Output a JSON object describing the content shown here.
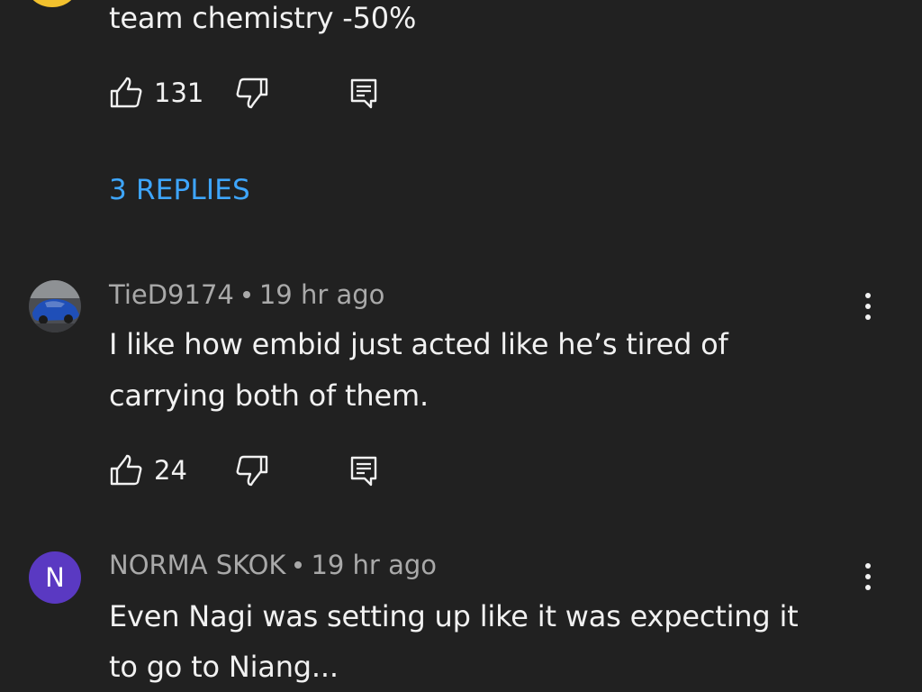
{
  "colors": {
    "background": "#212121",
    "primary_text": "#f1f1f1",
    "meta_text": "#a9a9a9",
    "link": "#3ea6ff",
    "avatar_letter_bg": "#5a39c2",
    "partial_avatar": "#f2c12e"
  },
  "comment_top": {
    "text_last_line": "team chemistry -50%",
    "likes": "131",
    "icons": [
      "thumbs-up-icon",
      "thumbs-down-icon",
      "reply-icon"
    ]
  },
  "replies_link": "3 REPLIES",
  "comments": [
    {
      "author": "TieD9174",
      "time": "19 hr ago",
      "avatar_icon": "car-avatar-image",
      "lines": [
        "I like how embid just acted like he’s tired of",
        "carrying both of them."
      ],
      "likes": "24"
    },
    {
      "author": "NORMA SKOK",
      "time": "19 hr ago",
      "avatar_letter": "N",
      "lines": [
        "Even Nagi was setting up like it was expecting it",
        "to go to Niang..."
      ]
    }
  ]
}
